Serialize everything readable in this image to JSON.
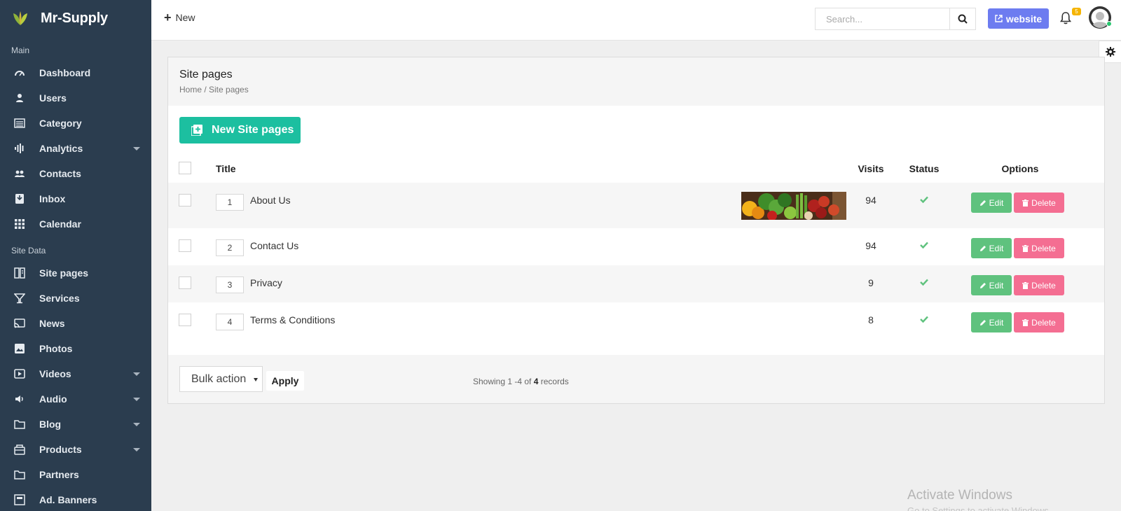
{
  "app": {
    "brand": "Mr-Supply"
  },
  "sidebar": {
    "sections": [
      "Main",
      "Site Data"
    ],
    "main_items": [
      {
        "label": "Dashboard",
        "icon": "gauge-icon",
        "dropdown": false
      },
      {
        "label": "Users",
        "icon": "user-icon",
        "dropdown": false
      },
      {
        "label": "Category",
        "icon": "list-icon",
        "dropdown": false
      },
      {
        "label": "Analytics",
        "icon": "analytics-icon",
        "dropdown": true
      },
      {
        "label": "Contacts",
        "icon": "contacts-icon",
        "dropdown": false
      },
      {
        "label": "Inbox",
        "icon": "inbox-icon",
        "dropdown": false
      },
      {
        "label": "Calendar",
        "icon": "calendar-icon",
        "dropdown": false
      }
    ],
    "data_items": [
      {
        "label": "Site pages",
        "icon": "pages-icon",
        "dropdown": false
      },
      {
        "label": "Services",
        "icon": "services-icon",
        "dropdown": false
      },
      {
        "label": "News",
        "icon": "rss-icon",
        "dropdown": false
      },
      {
        "label": "Photos",
        "icon": "photo-icon",
        "dropdown": false
      },
      {
        "label": "Videos",
        "icon": "video-icon",
        "dropdown": true
      },
      {
        "label": "Audio",
        "icon": "audio-icon",
        "dropdown": true
      },
      {
        "label": "Blog",
        "icon": "folder-icon",
        "dropdown": true
      },
      {
        "label": "Products",
        "icon": "products-icon",
        "dropdown": true
      },
      {
        "label": "Partners",
        "icon": "folder-icon",
        "dropdown": false
      },
      {
        "label": "Ad. Banners",
        "icon": "banner-icon",
        "dropdown": false
      }
    ]
  },
  "topbar": {
    "new_label": "New",
    "search_placeholder": "Search...",
    "website_label": "website",
    "notifications_count": "5"
  },
  "page": {
    "title": "Site pages",
    "breadcrumb": "Home / Site pages",
    "new_button": "New Site pages"
  },
  "table": {
    "headers": {
      "title": "Title",
      "visits": "Visits",
      "status": "Status",
      "options": "Options"
    },
    "edit_label": "Edit",
    "delete_label": "Delete",
    "rows": [
      {
        "order": "1",
        "title": "About Us",
        "visits": "94",
        "active": true,
        "has_image": true
      },
      {
        "order": "2",
        "title": "Contact Us",
        "visits": "94",
        "active": true,
        "has_image": false
      },
      {
        "order": "3",
        "title": "Privacy",
        "visits": "9",
        "active": true,
        "has_image": false
      },
      {
        "order": "4",
        "title": "Terms & Conditions",
        "visits": "8",
        "active": true,
        "has_image": false
      }
    ]
  },
  "footer": {
    "bulk_label": "Bulk action",
    "apply_label": "Apply",
    "records_prefix": "Showing 1 -4 of ",
    "records_total": "4",
    "records_suffix": " records"
  },
  "watermark": {
    "line1": "Activate Windows",
    "line2": "Go to Settings to activate Windows."
  },
  "colors": {
    "sidebar": "#2b3d4f",
    "primary": "#1cbfa0",
    "website": "#6d7cf0",
    "edit": "#5fc27e",
    "delete": "#f46e92",
    "check": "#5fc27e"
  }
}
